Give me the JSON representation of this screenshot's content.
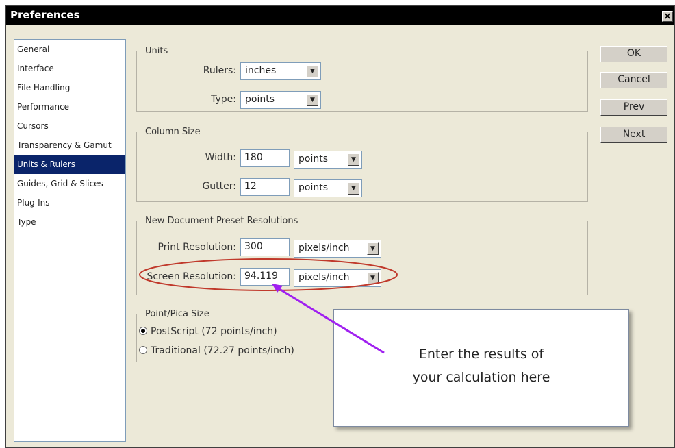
{
  "window": {
    "title": "Preferences",
    "close": "×"
  },
  "sidebar": {
    "items": [
      {
        "label": "General"
      },
      {
        "label": "Interface"
      },
      {
        "label": "File Handling"
      },
      {
        "label": "Performance"
      },
      {
        "label": "Cursors"
      },
      {
        "label": "Transparency & Gamut"
      },
      {
        "label": "Units & Rulers",
        "selected": true
      },
      {
        "label": "Guides, Grid & Slices"
      },
      {
        "label": "Plug-Ins"
      },
      {
        "label": "Type"
      }
    ]
  },
  "units": {
    "title": "Units",
    "rulers_label": "Rulers:",
    "rulers_value": "inches",
    "type_label": "Type:",
    "type_value": "points"
  },
  "column_size": {
    "title": "Column Size",
    "width_label": "Width:",
    "width_value": "180",
    "width_unit": "points",
    "gutter_label": "Gutter:",
    "gutter_value": "12",
    "gutter_unit": "points"
  },
  "preset_resolutions": {
    "title": "New Document Preset Resolutions",
    "print_label": "Print Resolution:",
    "print_value": "300",
    "print_unit": "pixels/inch",
    "screen_label": "Screen Resolution:",
    "screen_value": "94.119",
    "screen_unit": "pixels/inch"
  },
  "point_pica": {
    "title": "Point/Pica Size",
    "postscript_label": "PostScript (72 points/inch)",
    "traditional_label": "Traditional (72.27 points/inch)",
    "selected": "postscript"
  },
  "buttons": {
    "ok": "OK",
    "cancel": "Cancel",
    "prev": "Prev",
    "next": "Next"
  },
  "callout": {
    "line1": "Enter the results of",
    "line2": "your calculation here"
  },
  "colors": {
    "highlight": "#0a246a",
    "annotation_ellipse": "#c0392b",
    "annotation_arrow": "#a020f0"
  },
  "icons": {
    "dropdown": "chevron-down-icon",
    "close": "close-icon"
  }
}
